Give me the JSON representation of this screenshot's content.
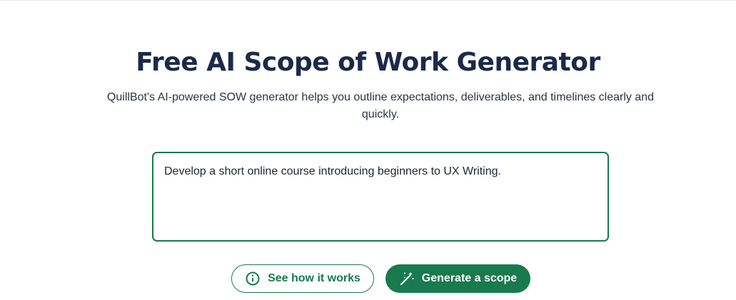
{
  "header": {
    "title": "Free AI Scope of Work Generator",
    "subtitle": "QuillBot's AI-powered SOW generator helps you outline expectations, deliverables, and timelines clearly and quickly."
  },
  "prompt": {
    "value": "Develop a short online course introducing beginners to UX Writing."
  },
  "actions": {
    "see_how_label": "See how it works",
    "see_how_icon": "info-circle-icon",
    "generate_label": "Generate a scope",
    "generate_icon": "magic-wand-icon"
  },
  "colors": {
    "accent": "#187a4e",
    "title_text": "#1b2a4a",
    "body_text": "#2b3345"
  }
}
